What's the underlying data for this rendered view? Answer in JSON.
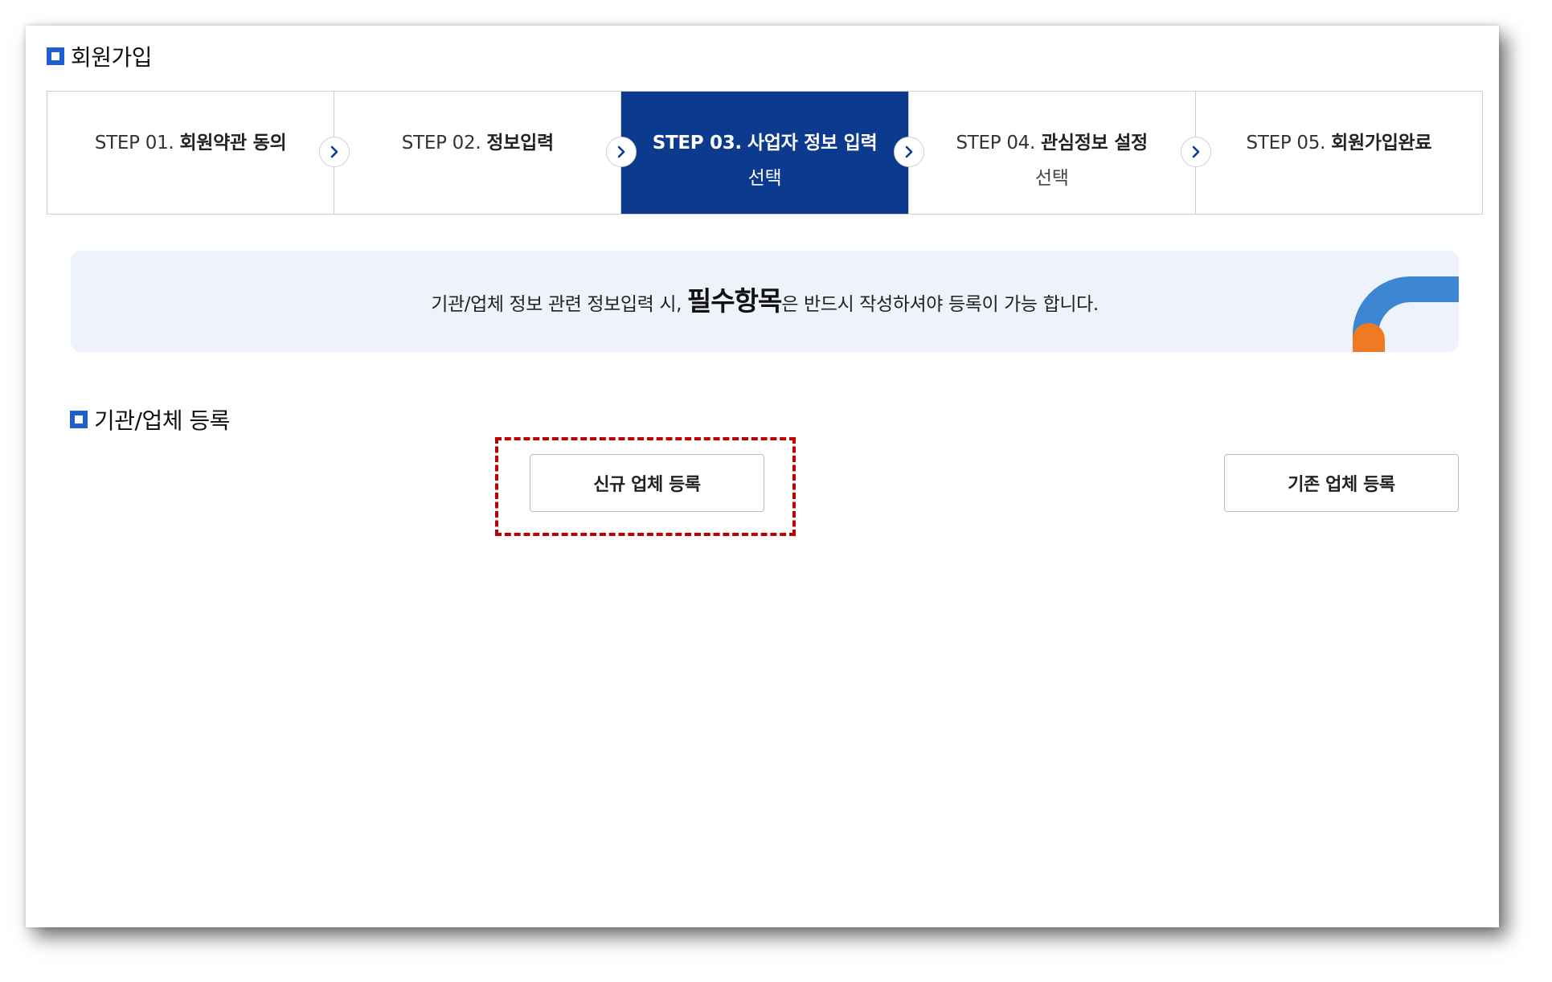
{
  "page": {
    "title": "회원가입"
  },
  "steps": [
    {
      "num": "STEP 01.",
      "name": "회원약관 동의",
      "sub": "",
      "active": false
    },
    {
      "num": "STEP 02.",
      "name": "정보입력",
      "sub": "",
      "active": false
    },
    {
      "num": "STEP 03.",
      "name": "사업자 정보 입력",
      "sub": "선택",
      "active": true
    },
    {
      "num": "STEP 04.",
      "name": "관심정보 설정",
      "sub": "선택",
      "active": false
    },
    {
      "num": "STEP 05.",
      "name": "회원가입완료",
      "sub": "",
      "active": false
    }
  ],
  "notice": {
    "before": "기관/업체 정보 관련 정보입력 시, ",
    "emphasis": "필수항목",
    "after": "은 반드시 작성하셔야 등록이 가능 합니다."
  },
  "registration": {
    "title": "기관/업체 등록",
    "new_button": "신규 업체 등록",
    "existing_button": "기존 업체 등록"
  },
  "colors": {
    "accent_blue": "#1e5fcf",
    "active_step_bg": "#0c3a8e",
    "notice_bg": "#eef2fa",
    "highlight_red": "#c00000",
    "deco_blue": "#3d86d3",
    "deco_orange": "#f07a22"
  },
  "icons": {
    "section_marker": "square-icon",
    "step_arrow": "chevron-right-icon"
  }
}
